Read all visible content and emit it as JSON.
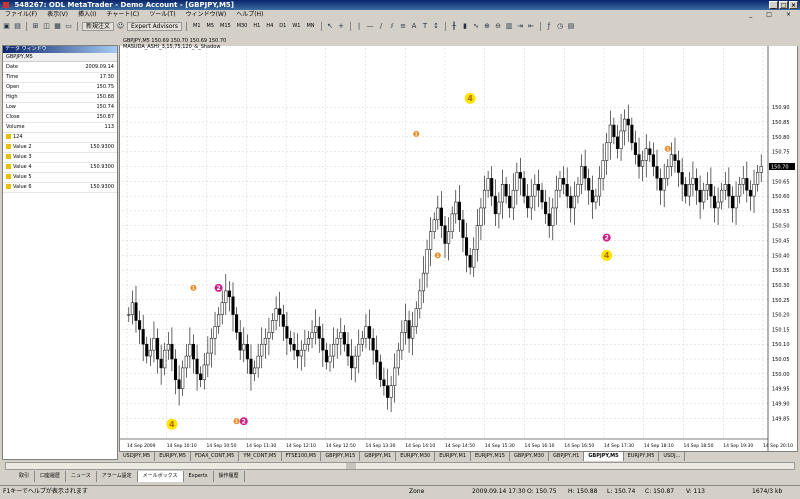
{
  "window": {
    "title": "548267: ODL MetaTrader - Demo Account - [GBPJPY,M5]"
  },
  "menu": [
    "ファイル(F)",
    "表示(V)",
    "挿入(I)",
    "チャート(C)",
    "ツール(T)",
    "ウィンドウ(W)",
    "ヘルプ(H)"
  ],
  "toolbar": {
    "new_order": "新規注文",
    "expert_advisors": "Expert Advisors",
    "timeframes": [
      "M1",
      "M5",
      "M15",
      "M30",
      "H1",
      "H4",
      "D1",
      "W1",
      "MN"
    ]
  },
  "data_window": {
    "title": "データ ウィンドウ",
    "symbol": "GBPJPY,M5",
    "rows": [
      {
        "key": "Date",
        "value": "2009.09.14"
      },
      {
        "key": "Time",
        "value": "17:30"
      },
      {
        "key": "Open",
        "value": "150.75"
      },
      {
        "key": "High",
        "value": "150.88"
      },
      {
        "key": "Low",
        "value": "150.74"
      },
      {
        "key": "Close",
        "value": "150.87"
      },
      {
        "key": "Volume",
        "value": "113"
      }
    ],
    "indicators": [
      {
        "key": "124",
        "value": ""
      },
      {
        "key": "Value 2",
        "value": "150.9300"
      },
      {
        "key": "Value 3",
        "value": ""
      },
      {
        "key": "Value 4",
        "value": "150.9300"
      },
      {
        "key": "Value 5",
        "value": ""
      },
      {
        "key": "Value 6",
        "value": "150.9300"
      }
    ]
  },
  "chart_data": {
    "type": "candlestick",
    "title": "GBPJPY,M5  150.69 150.70 150.69 150.70",
    "indicator_label": "MASUDA_ASHI_3,15,75,120_&_Shadow",
    "ylim": [
      149.78,
      151.1
    ],
    "price_ticks": [
      "150.90",
      "150.85",
      "150.80",
      "150.75",
      "150.70",
      "150.65",
      "150.60",
      "150.55",
      "150.50",
      "150.45",
      "150.40",
      "150.35",
      "150.30",
      "150.25",
      "150.20",
      "150.15",
      "150.10",
      "150.05",
      "150.00",
      "149.95",
      "149.90",
      "149.85"
    ],
    "current_price": "150.70",
    "x_ticks": [
      "14 Sep 2009",
      "14 Sep 10:10",
      "14 Sep 10:50",
      "14 Sep 11:30",
      "14 Sep 12:10",
      "14 Sep 12:50",
      "14 Sep 13:30",
      "14 Sep 14:10",
      "14 Sep 14:50",
      "14 Sep 15:30",
      "14 Sep 16:10",
      "14 Sep 16:50",
      "14 Sep 17:30",
      "14 Sep 18:10",
      "14 Sep 18:50",
      "14 Sep 19:30",
      "14 Sep 20:10"
    ],
    "closes": [
      150.2,
      150.24,
      150.18,
      150.15,
      150.1,
      150.06,
      150.08,
      150.12,
      150.05,
      150.02,
      150.08,
      150.1,
      150.05,
      149.98,
      149.95,
      150.02,
      150.06,
      150.1,
      150.05,
      150.0,
      149.98,
      150.03,
      150.07,
      150.12,
      150.16,
      150.2,
      150.24,
      150.28,
      150.26,
      150.2,
      150.14,
      150.08,
      150.1,
      150.05,
      150.0,
      150.02,
      150.06,
      150.1,
      150.12,
      150.14,
      150.18,
      150.22,
      150.2,
      150.16,
      150.12,
      150.1,
      150.08,
      150.06,
      150.08,
      150.1,
      150.12,
      150.14,
      150.16,
      150.12,
      150.08,
      150.04,
      150.06,
      150.1,
      150.12,
      150.14,
      150.1,
      150.06,
      150.02,
      150.06,
      150.1,
      150.12,
      150.16,
      150.12,
      150.08,
      150.04,
      149.98,
      149.96,
      149.92,
      149.96,
      150.02,
      150.08,
      150.14,
      150.18,
      150.12,
      150.16,
      150.22,
      150.28,
      150.34,
      150.42,
      150.48,
      150.52,
      150.56,
      150.5,
      150.44,
      150.48,
      150.54,
      150.58,
      150.52,
      150.46,
      150.4,
      150.36,
      150.42,
      150.5,
      150.56,
      150.62,
      150.66,
      150.6,
      150.54,
      150.58,
      150.64,
      150.6,
      150.56,
      150.62,
      150.68,
      150.66,
      150.6,
      150.56,
      150.6,
      150.64,
      150.62,
      150.58,
      150.54,
      150.5,
      150.56,
      150.62,
      150.66,
      150.64,
      150.6,
      150.56,
      150.6,
      150.64,
      150.7,
      150.66,
      150.62,
      150.58,
      150.6,
      150.66,
      150.72,
      150.78,
      150.84,
      150.8,
      150.76,
      150.82,
      150.86,
      150.84,
      150.78,
      150.74,
      150.7,
      150.72,
      150.76,
      150.74,
      150.7,
      150.66,
      150.62,
      150.66,
      150.7,
      150.74,
      150.72,
      150.68,
      150.64,
      150.6,
      150.64,
      150.66,
      150.62,
      150.58,
      150.62,
      150.64,
      150.6,
      150.56,
      150.58,
      150.62,
      150.64,
      150.6,
      150.56,
      150.6,
      150.64,
      150.66,
      150.62,
      150.6,
      150.64,
      150.68,
      150.7
    ],
    "markers": [
      {
        "label": "4",
        "kind": "big-yellow",
        "bar": 95,
        "price": 150.93
      },
      {
        "label": "4",
        "kind": "big-yellow",
        "bar": 12,
        "price": 149.83
      },
      {
        "label": "4",
        "kind": "big-yellow",
        "bar": 133,
        "price": 150.4
      },
      {
        "label": "2",
        "kind": "magenta",
        "bar": 25,
        "price": 150.29
      },
      {
        "label": "2",
        "kind": "magenta",
        "bar": 32,
        "price": 149.84
      },
      {
        "label": "2",
        "kind": "magenta",
        "bar": 133,
        "price": 150.46
      },
      {
        "label": "1",
        "kind": "orange",
        "bar": 18,
        "price": 150.29
      },
      {
        "label": "1",
        "kind": "orange",
        "bar": 30,
        "price": 149.84
      },
      {
        "label": "1",
        "kind": "orange",
        "bar": 80,
        "price": 150.81
      },
      {
        "label": "1",
        "kind": "orange",
        "bar": 86,
        "price": 150.4
      },
      {
        "label": "1",
        "kind": "orange",
        "bar": 150,
        "price": 150.76
      }
    ]
  },
  "symbol_tabs": [
    "USDJPY,M5",
    "EURJPY,M5",
    "FDAX_CONT,M5",
    "YM_CONT,M5",
    "FTSE100,M5",
    "GBPJPY,M15",
    "GBPJPY,M1",
    "EURJPY,M30",
    "EURJPY,M1",
    "EURJPY,M15",
    "GBPJPY,M30",
    "GBPJPY,H1",
    "GBPJPY,M5",
    "EURJPY,M5",
    "USDJ..."
  ],
  "active_symbol_tab": "GBPJPY,M5",
  "bottom_tabs": [
    "取引",
    "口座履歴",
    "ニュース",
    "アラーム設定",
    "メールボックス",
    "Experts",
    "操作履歴"
  ],
  "active_bottom_tab": "メールボックス",
  "status": {
    "help": "F1キーでヘルプが表示されます",
    "zone": "Zone",
    "datetime": "2009.09.14 17:30",
    "open": "O: 150.75",
    "high": "H: 150.88",
    "low": "L: 150.74",
    "close": "C: 150.87",
    "volume": "V: 113",
    "traffic": "1674/3 kb"
  }
}
